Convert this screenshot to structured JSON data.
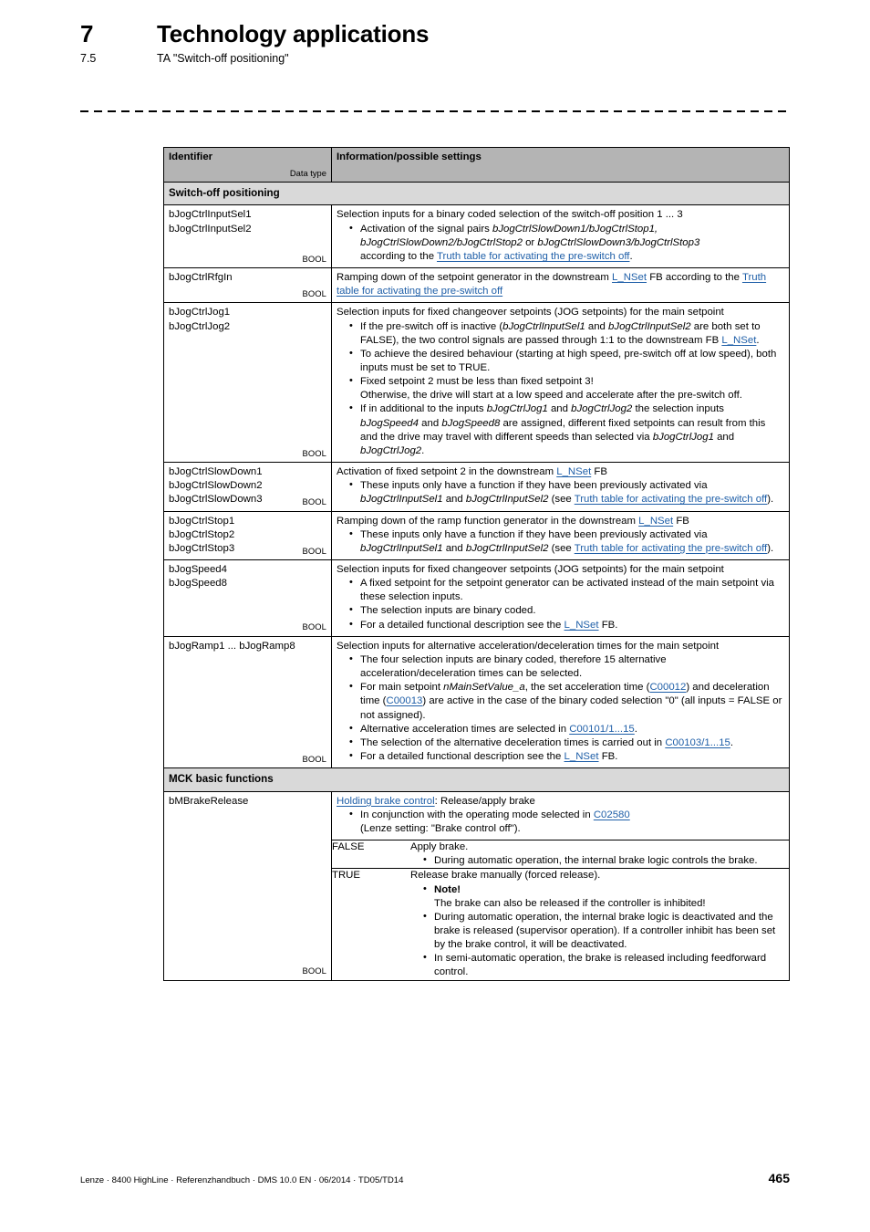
{
  "header": {
    "chapter_number": "7",
    "chapter_title": "Technology applications",
    "section_number": "7.5",
    "section_title": "TA \"Switch-off positioning\""
  },
  "table": {
    "head": {
      "identifier": "Identifier",
      "data_type": "Data type",
      "information": "Information/possible settings"
    },
    "sections": {
      "switch_off": "Switch-off positioning",
      "mck": "MCK basic functions"
    },
    "rows": {
      "inputsel": {
        "ids": [
          "bJogCtrlInputSel1",
          "bJogCtrlInputSel2"
        ],
        "bool": "BOOL",
        "lead": "Selection inputs for a binary coded selection of the switch-off position 1 ... 3",
        "b1_a": "Activation of the signal pairs ",
        "b1_i1": "bJogCtrlSlowDown1/bJogCtrlStop1,",
        "b1_i2": "bJogCtrlSlowDown2/bJogCtrlStop2",
        "b1_b": " or ",
        "b1_i3": "bJogCtrlSlowDown3/bJogCtrlStop3",
        "b1_c": "according to the ",
        "b1_link": "Truth table for activating the pre-switch off",
        "b1_d": "."
      },
      "rfgin": {
        "ids": [
          "bJogCtrlRfgIn"
        ],
        "bool": "BOOL",
        "t1": "Ramping down of the setpoint generator in the downstream ",
        "link1": "L_NSet",
        "t2": " FB according to the ",
        "link2": "Truth table for activating the pre-switch off"
      },
      "jog": {
        "ids": [
          "bJogCtrlJog1",
          "bJogCtrlJog2"
        ],
        "bool": "BOOL",
        "lead": "Selection inputs for fixed changeover setpoints (JOG setpoints) for the main setpoint",
        "b1_a": "If the pre-switch off is inactive (",
        "b1_i1": "bJogCtrlInputSel1",
        "b1_b": " and ",
        "b1_i2": "bJogCtrlInputSel2",
        "b1_c": " are both set to FALSE), the two control signals are passed through 1:1 to the downstream FB ",
        "b1_link": "L_NSet",
        "b1_d": ".",
        "b2": "To achieve the desired behaviour (starting at high speed, pre-switch off at low speed), both inputs must be set to TRUE.",
        "b3_l1": "Fixed setpoint 2 must be less than fixed setpoint 3!",
        "b3_l2": "Otherwise, the drive will start at a low speed and accelerate after the pre-switch off.",
        "b4_a": "If in additional to the inputs ",
        "b4_i1": "bJogCtrlJog1",
        "b4_b": " and ",
        "b4_i2": "bJogCtrlJog2",
        "b4_c": " the selection inputs ",
        "b4_i3": "bJogSpeed4",
        "b4_d": " and ",
        "b4_i4": "bJogSpeed8",
        "b4_e": " are assigned, different fixed setpoints can result from this and the drive may travel with different speeds than selected via ",
        "b4_i5": "bJogCtrlJog1",
        "b4_f": " and ",
        "b4_i6": "bJogCtrlJog2",
        "b4_g": "."
      },
      "slowdown": {
        "ids": [
          "bJogCtrlSlowDown1",
          "bJogCtrlSlowDown2",
          "bJogCtrlSlowDown3"
        ],
        "bool": "BOOL",
        "lead_a": "Activation of fixed setpoint 2 in the downstream ",
        "lead_link": "L_NSet",
        "lead_b": " FB",
        "b1_a": "These inputs only have a function if they have been previously activated via ",
        "b1_i1": "bJogCtrlInputSel1",
        "b1_b": " and ",
        "b1_i2": "bJogCtrlInputSel2",
        "b1_c": " (see ",
        "b1_link": "Truth table for activating the pre-switch off",
        "b1_d": ")."
      },
      "stop": {
        "ids": [
          "bJogCtrlStop1",
          "bJogCtrlStop2",
          "bJogCtrlStop3"
        ],
        "bool": "BOOL",
        "lead_a": "Ramping down of the ramp function generator in the downstream ",
        "lead_link": "L_NSet",
        "lead_b": " FB",
        "b1_a": "These inputs only have a function if they have been previously activated via ",
        "b1_i1": "bJogCtrlInputSel1",
        "b1_b": " and ",
        "b1_i2": "bJogCtrlInputSel2",
        "b1_c": " (see ",
        "b1_link": "Truth table for activating the pre-switch off",
        "b1_d": ")."
      },
      "speed": {
        "ids": [
          "bJogSpeed4",
          "bJogSpeed8"
        ],
        "bool": "BOOL",
        "lead": "Selection inputs for fixed changeover setpoints (JOG setpoints) for the main setpoint",
        "b1": "A fixed setpoint for the setpoint generator can be activated instead of the main setpoint via these selection inputs.",
        "b2": "The selection inputs are binary coded.",
        "b3_a": "For a detailed functional description see the ",
        "b3_link": "L_NSet",
        "b3_b": " FB."
      },
      "ramp": {
        "ids": [
          "bJogRamp1 ... bJogRamp8"
        ],
        "bool": "BOOL",
        "lead": "Selection inputs for alternative acceleration/deceleration times for the main setpoint",
        "b1": "The four selection inputs are binary coded, therefore 15 alternative acceleration/deceleration times can be selected.",
        "b2_a": "For main setpoint ",
        "b2_i1": "nMainSetValue_a",
        "b2_b": ", the set acceleration time (",
        "b2_link1": "C00012",
        "b2_c": ") and deceleration time (",
        "b2_link2": "C00013",
        "b2_d": ") are active in the case of the binary coded selection \"0\" (all inputs = FALSE or not assigned).",
        "b3_a": "Alternative acceleration times are selected in ",
        "b3_link": "C00101/1...15",
        "b3_b": ".",
        "b4_a": "The selection of the alternative deceleration times is carried out in ",
        "b4_link": "C00103/1...15",
        "b4_b": ".",
        "b5_a": "For a detailed functional description see the ",
        "b5_link": "L_NSet",
        "b5_b": " FB."
      },
      "brake": {
        "ids": [
          "bMBrakeRelease"
        ],
        "bool": "BOOL",
        "lead_link": "Holding brake control",
        "lead_a": ": Release/apply brake",
        "b1_a": "In conjunction with the operating mode selected in ",
        "b1_link": "C02580",
        "b1_b": "(Lenze setting: \"Brake control off\").",
        "false_key": "FALSE",
        "false_lead": "Apply brake.",
        "false_b1": "During automatic operation, the internal brake logic controls the brake.",
        "true_key": "TRUE",
        "true_lead": "Release brake manually (forced release).",
        "true_b1_note": "Note!",
        "true_b1_text": "The brake can also be released if the controller is inhibited!",
        "true_b2": "During automatic operation, the internal brake logic is deactivated and the brake is released (supervisor operation). If a controller inhibit has been set by the brake control, it will be deactivated.",
        "true_b3": "In semi-automatic operation, the brake is released including feedforward control."
      }
    }
  },
  "footer": {
    "text": "Lenze · 8400 HighLine · Referenzhandbuch · DMS 10.0 EN · 06/2014 · TD05/TD14",
    "page": "465"
  },
  "colors": {
    "header_gray": "#b4b4b4",
    "section_gray": "#d9d9d9",
    "link_blue": "#1f5fa8"
  }
}
